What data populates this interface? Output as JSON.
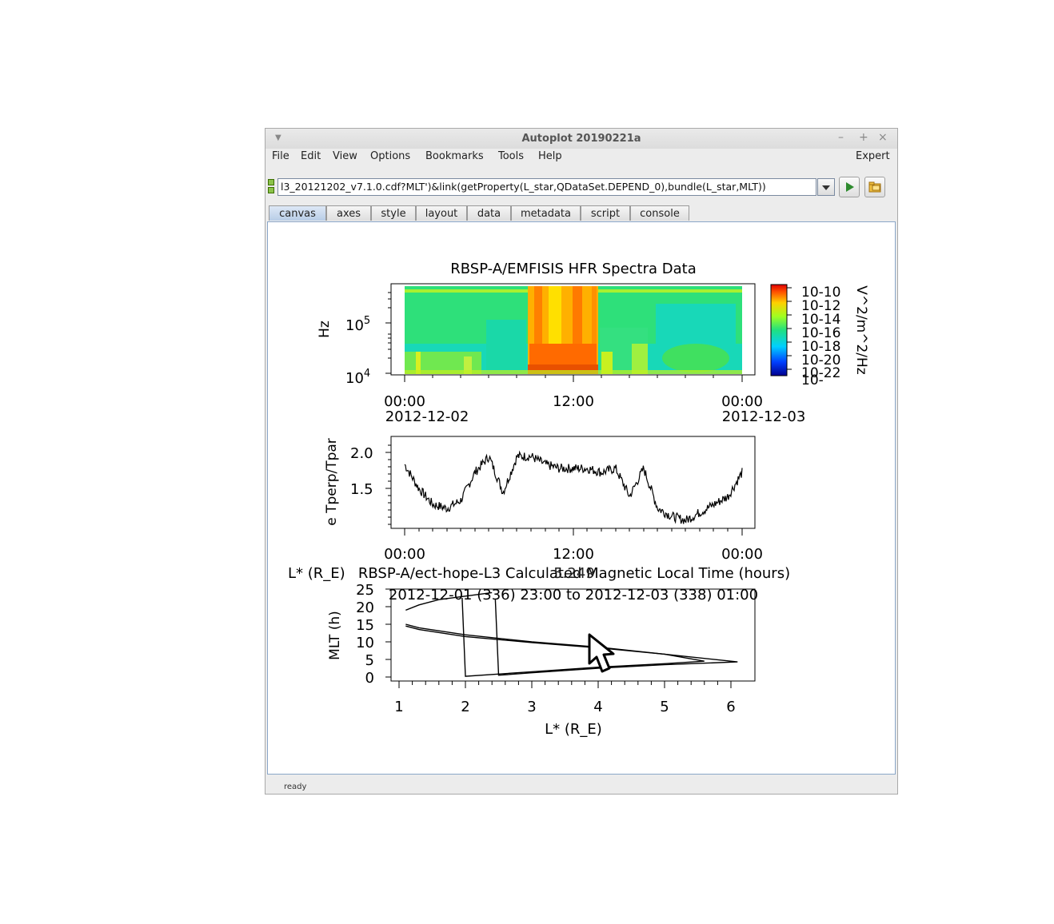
{
  "window": {
    "title": "Autoplot 20190221a",
    "minimize": "–",
    "maximize": "+",
    "close": "×"
  },
  "menu": {
    "file": "File",
    "edit": "Edit",
    "view": "View",
    "options": "Options",
    "bookmarks": "Bookmarks",
    "tools": "Tools",
    "help": "Help",
    "expert": "Expert"
  },
  "url": {
    "value": "l3_20121202_v7.1.0.cdf?MLT')&link(getProperty(L_star,QDataSet.DEPEND_0),bundle(L_star,MLT))"
  },
  "tabs": [
    "canvas",
    "axes",
    "style",
    "layout",
    "data",
    "metadata",
    "script",
    "console"
  ],
  "status": "ready",
  "plot1": {
    "title": "RBSP-A/EMFISIS  HFR Spectra Data",
    "ylabel": "Hz",
    "ytick_1e4_base": "10",
    "ytick_1e4_exp": "4",
    "ytick_1e5_base": "10",
    "ytick_1e5_exp": "5",
    "xtick_0": "00:00",
    "xtick_0_date": "2012-12-02",
    "xtick_12": "12:00",
    "xtick_24": "00:00",
    "xtick_24_date": "2012-12-03",
    "colorbar_label": "V^2/m^2/Hz",
    "colorbar_ticks": [
      "10-10",
      "10-12",
      "10-14",
      "10-16",
      "10-18",
      "10-20",
      "10-22",
      "10-"
    ]
  },
  "plot2": {
    "ylabel": "e Tperp/Tpar",
    "ytick_20": "2.0",
    "ytick_15": "1.5",
    "xtick_0": "00:00",
    "xtick_12": "12:00",
    "xtick_24": "00:00"
  },
  "plot3": {
    "title": "RBSP-A/ect-hope-L3  Calculated Magnetic Local Time (hours)",
    "subtitle": "2012-12-01 (336) 23:00 to 2012-12-03 (338) 01:00",
    "left_label": "L* (R_E)",
    "overlap_label": "5.249",
    "ylabel": "MLT (h)",
    "xlabel": "L* (R_E)",
    "yticks": [
      "25",
      "20",
      "15",
      "10",
      "5",
      "0"
    ],
    "xticks": [
      "1",
      "2",
      "3",
      "4",
      "5",
      "6"
    ]
  },
  "chart_data": [
    {
      "type": "heatmap",
      "title": "RBSP-A/EMFISIS  HFR Spectra Data",
      "ylabel": "Hz",
      "yscale": "log",
      "ylim": [
        10000,
        500000
      ],
      "x_ticks": [
        "00:00 2012-12-02",
        "12:00",
        "00:00 2012-12-03"
      ],
      "colorbar": {
        "label": "V^2/m^2/Hz",
        "scale": "log",
        "range": [
          1e-22,
          1e-10
        ]
      }
    },
    {
      "type": "line",
      "ylabel": "e Tperp/Tpar",
      "ylim": [
        1.05,
        2.2
      ],
      "x_ticks": [
        "00:00",
        "12:00",
        "00:00"
      ],
      "x_hours": [
        0,
        1,
        2,
        3,
        4,
        5,
        6,
        7,
        8,
        9,
        10,
        11,
        12,
        13,
        14,
        15,
        16,
        17,
        18,
        19,
        20,
        21,
        22,
        23,
        24
      ],
      "values": [
        1.85,
        1.55,
        1.35,
        1.3,
        1.4,
        1.75,
        1.95,
        1.5,
        1.95,
        1.95,
        1.85,
        1.8,
        1.8,
        1.8,
        1.75,
        1.8,
        1.45,
        1.8,
        1.3,
        1.2,
        1.15,
        1.25,
        1.35,
        1.45,
        1.75
      ]
    },
    {
      "type": "line",
      "title": "RBSP-A/ect-hope-L3  Calculated Magnetic Local Time (hours)",
      "xlabel": "L* (R_E)",
      "ylabel": "MLT (h)",
      "xlim": [
        0.9,
        6.3
      ],
      "ylim": [
        -1,
        25
      ],
      "series": [
        {
          "x": [
            1.1,
            1.3,
            1.6,
            2.0,
            2.4
          ],
          "y": [
            19,
            20.5,
            22,
            23,
            24
          ]
        },
        {
          "x": [
            1.1,
            1.3,
            2.0,
            3.0,
            4.0,
            5.0,
            6.0,
            6.1,
            5.0,
            4.0,
            3.0,
            2.5,
            2.45
          ],
          "y": [
            15,
            14,
            12,
            10,
            8.5,
            6.5,
            4.5,
            4.3,
            3.5,
            2.5,
            1.2,
            0.5,
            22
          ]
        },
        {
          "x": [
            1.1,
            1.3,
            2.0,
            3.0,
            4.0,
            5.0,
            5.6,
            5.0,
            4.0,
            3.0,
            2.0,
            1.95
          ],
          "y": [
            14.5,
            13.5,
            11.5,
            9.8,
            8.3,
            6.5,
            4.5,
            3.8,
            2.8,
            1.5,
            0.2,
            22.5
          ]
        }
      ]
    }
  ]
}
